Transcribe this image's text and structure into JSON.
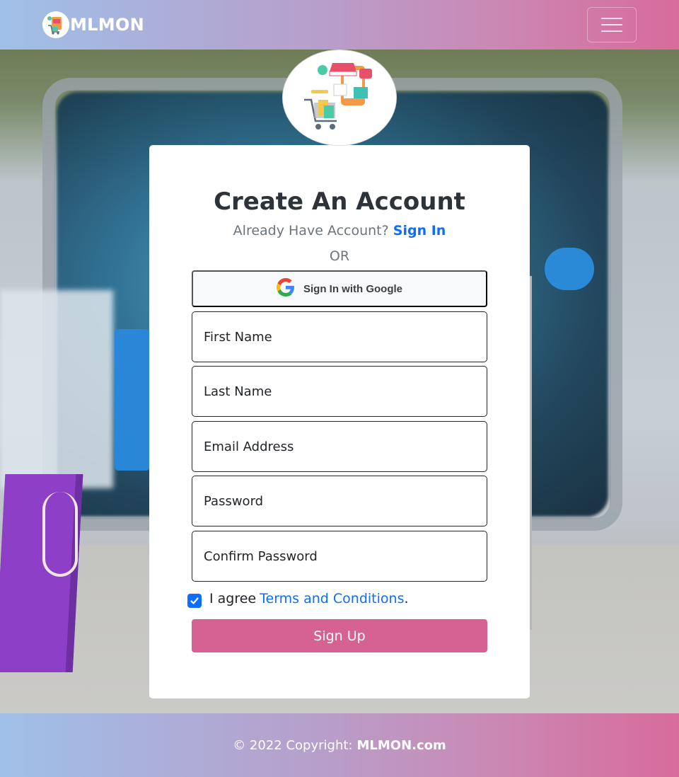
{
  "navbar": {
    "brand_text": "MLMON",
    "logo_icon": "shopping-logo-icon",
    "menu_icon": "hamburger-menu-icon"
  },
  "form": {
    "title": "Create An Account",
    "have_account_text": "Already Have Account?",
    "sign_in_link": "Sign In",
    "or_text": "OR",
    "google_button_label": "Sign In with Google",
    "first_name_placeholder": "First Name",
    "last_name_placeholder": "Last Name",
    "email_placeholder": "Email Address",
    "password_placeholder": "Password",
    "confirm_password_placeholder": "Confirm Password",
    "agree_text": "I agree",
    "terms_link": "Terms and Conditions",
    "terms_suffix": ".",
    "agree_checked": true,
    "sign_up_label": "Sign Up"
  },
  "footer": {
    "copyright_text": "© 2022 Copyright:",
    "site_name": "MLMON.com"
  },
  "colors": {
    "primary_link": "#0d6efd",
    "sign_up_button": "#d66293",
    "gradient_start": "#9fc0e8",
    "gradient_end": "#d86b9b"
  }
}
